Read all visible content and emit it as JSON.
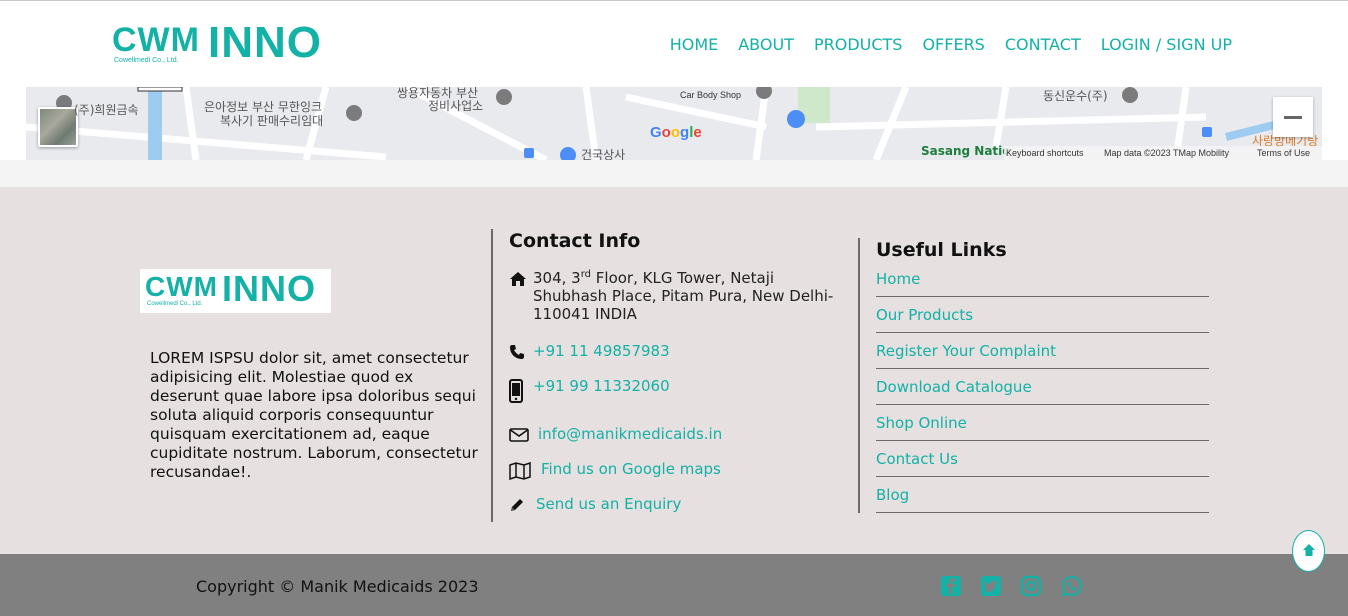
{
  "brand": {
    "logo_main": "CWM",
    "logo_secondary": "INNO",
    "logo_tagline": "Cowellmedi Co., Ltd.",
    "accent_color": "#13b1a6"
  },
  "nav": {
    "items": [
      {
        "label": "HOME"
      },
      {
        "label": "ABOUT"
      },
      {
        "label": "PRODUCTS"
      },
      {
        "label": "OFFERS"
      },
      {
        "label": "CONTACT"
      },
      {
        "label": "LOGIN / SIGN UP"
      }
    ]
  },
  "map": {
    "labels": {
      "place1": "(주)희원금속",
      "place2": "은아정보 부산 무한잉크",
      "place2b": "복사기 판매수리임대",
      "place3": "쌍용자동차 부산",
      "place3b": "정비사업소",
      "place4": "Car Body Shop",
      "place5": "동신운수(주)",
      "place6": "건국상사",
      "place7": "Sasang Natio",
      "place8": "사랑방메기탕"
    },
    "google_logo": "Google",
    "attribution": {
      "shortcuts": "Keyboard shortcuts",
      "map_data": "Map data ©2023 TMap Mobility",
      "terms": "Terms of Use"
    }
  },
  "footer": {
    "about_text": "LOREM ISPSU dolor sit, amet consectetur adipisicing elit. Molestiae quod ex deserunt quae labore ipsa doloribus sequi soluta aliquid corporis consequuntur quisquam exercitationem ad, eaque cupiditate nostrum. Laborum, consectetur recusandae!.",
    "contact": {
      "title": "Contact Info",
      "address_pre": "304, 3",
      "address_sup": "rd",
      "address_post": " Floor, KLG Tower, Netaji Shubhash Place, Pitam Pura, New Delhi-110041 INDIA",
      "phone": "+91 11 49857983",
      "mobile": "+91 99 11332060",
      "email": "info@manikmedicaids.in",
      "map_link": "Find us on Google maps",
      "enquiry": "Send us an Enquiry"
    },
    "useful_links": {
      "title": "Useful Links",
      "items": [
        {
          "label": "Home"
        },
        {
          "label": "Our Products"
        },
        {
          "label": "Register Your Complaint"
        },
        {
          "label": "Download Catalogue"
        },
        {
          "label": "Shop Online"
        },
        {
          "label": "Contact Us"
        },
        {
          "label": "Blog"
        }
      ]
    }
  },
  "bottom_bar": {
    "copyright": "Copyright © Manik Medicaids 2023",
    "social": [
      {
        "icon": "facebook-icon"
      },
      {
        "icon": "twitter-icon"
      },
      {
        "icon": "instagram-icon"
      },
      {
        "icon": "whatsapp-icon"
      }
    ]
  }
}
